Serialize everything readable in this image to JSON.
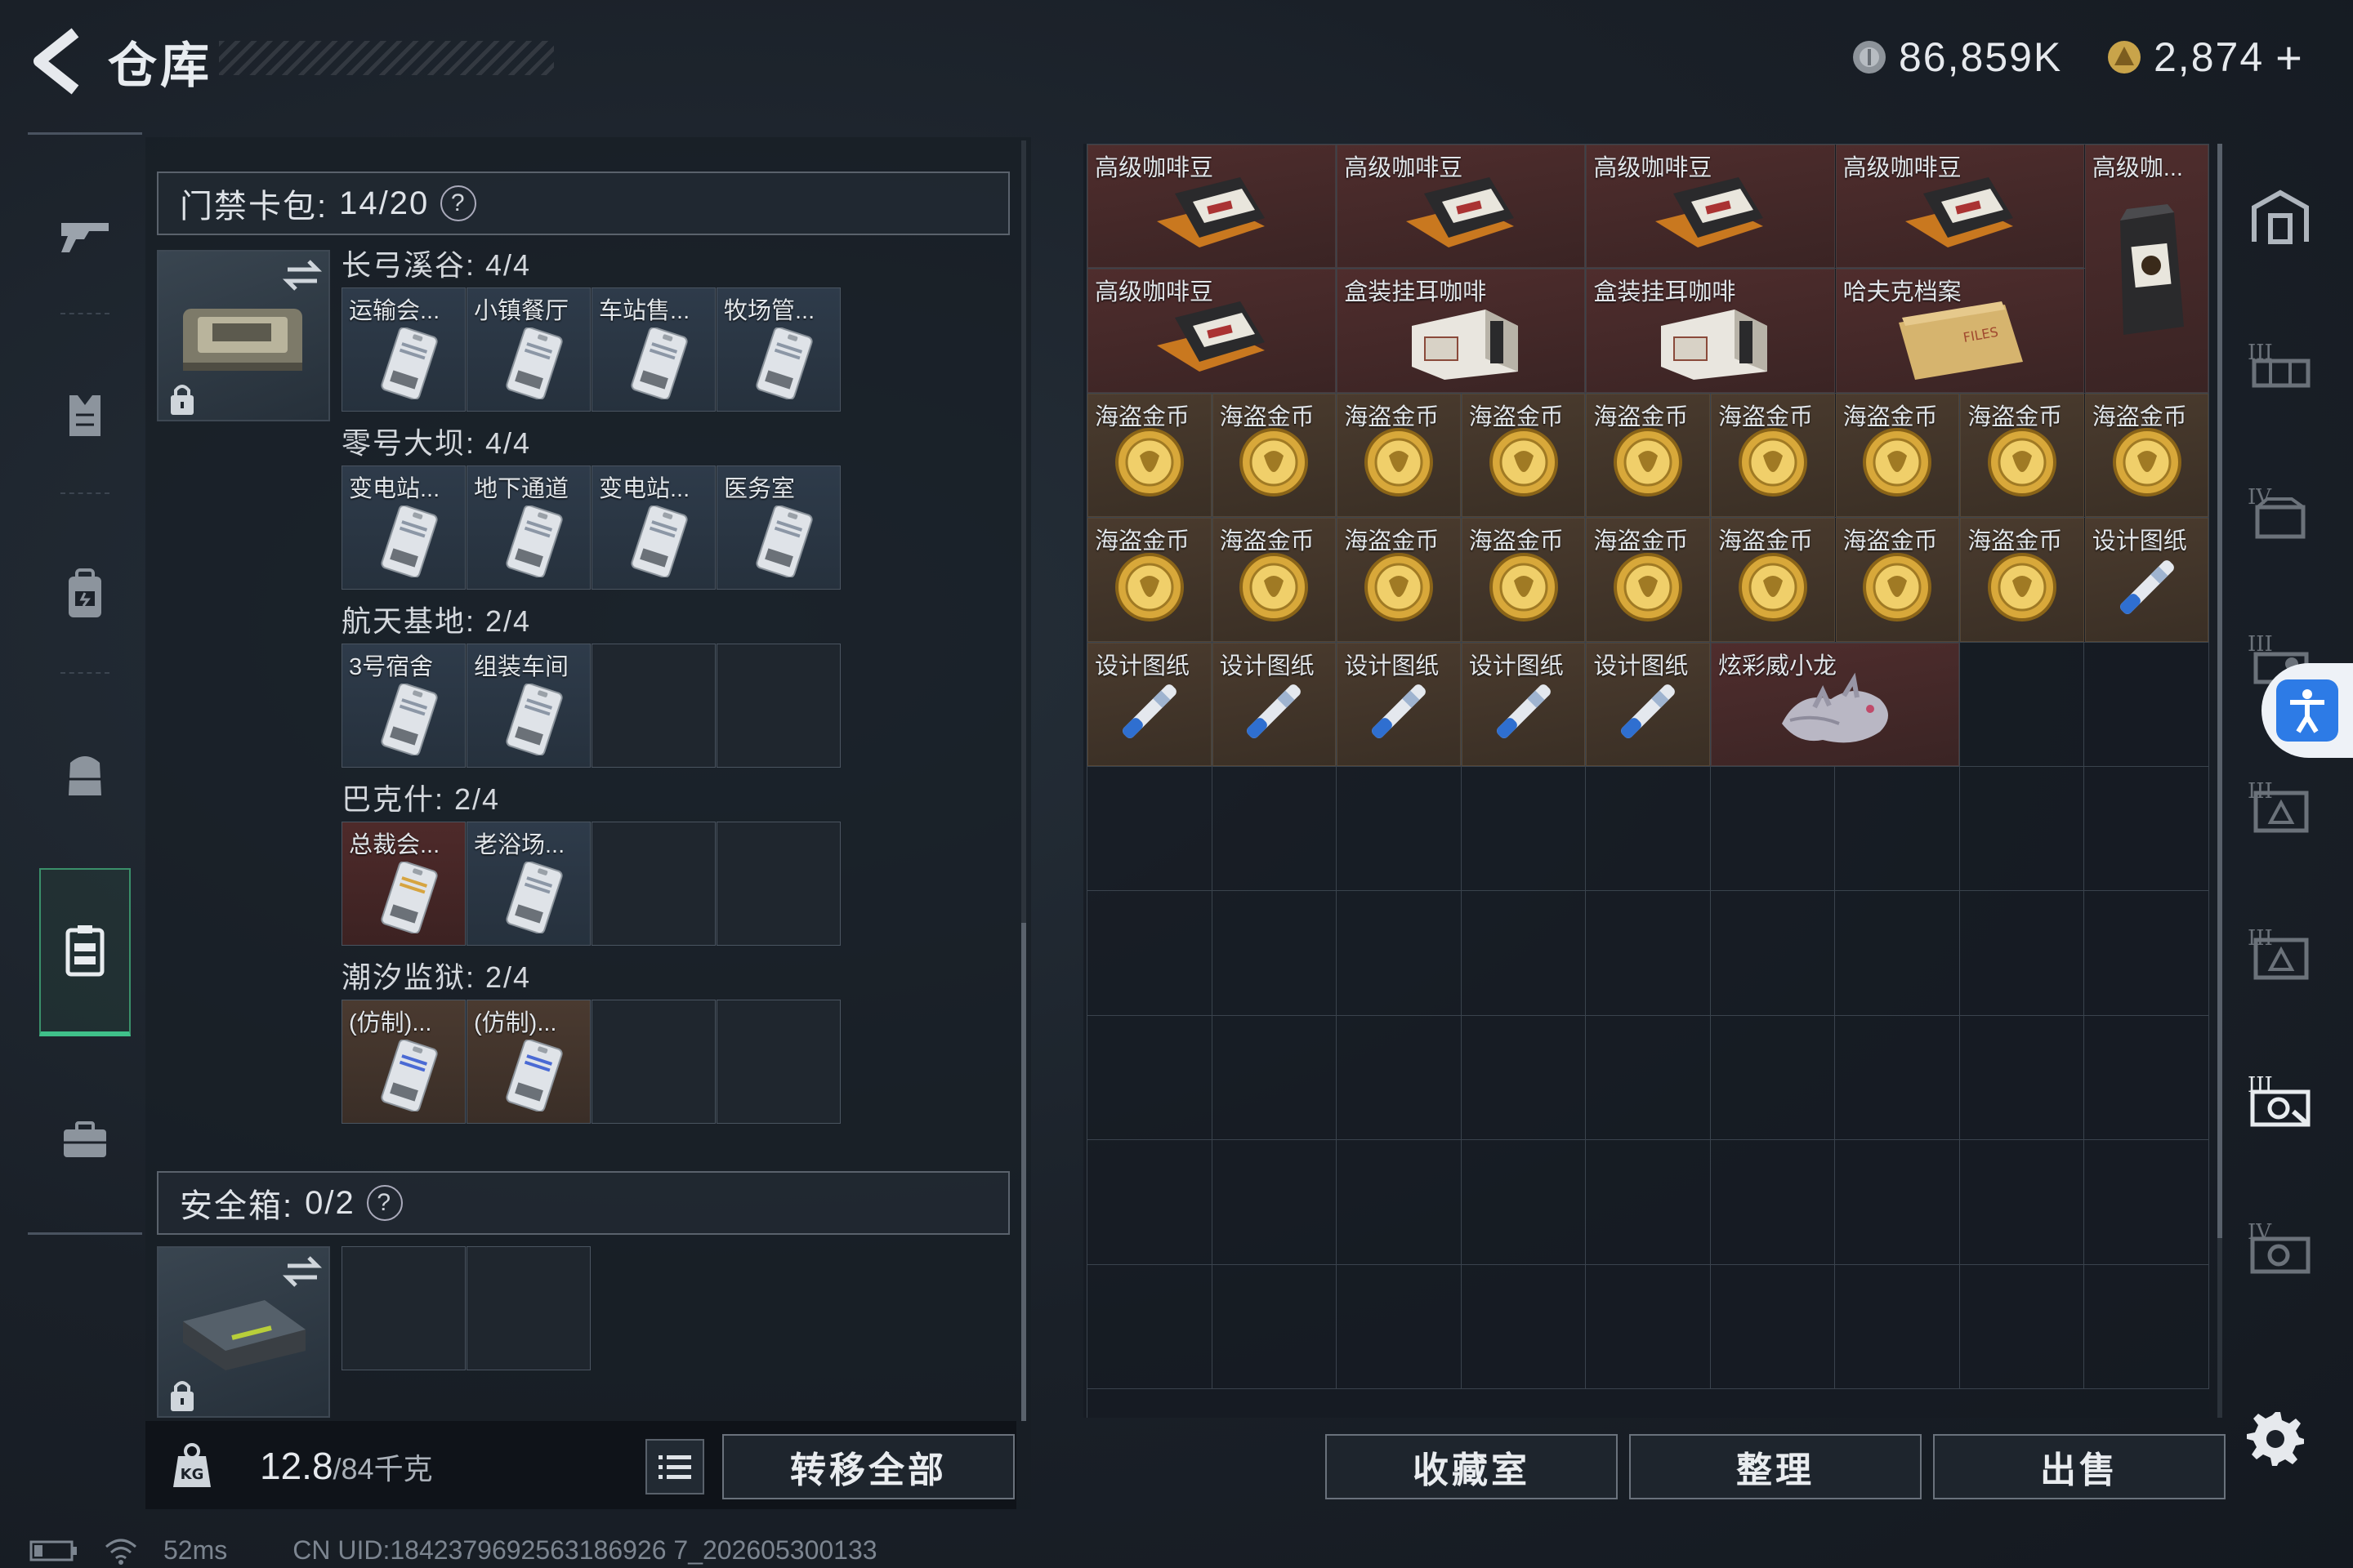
{
  "header": {
    "title": "仓库",
    "currency_1": "86,859K",
    "currency_2": "2,874",
    "currency_2_add": "+"
  },
  "nav": {
    "icons": [
      "gun-icon",
      "armor-vest-icon",
      "backpack-icon",
      "chest-rig-icon",
      "keycard-case-icon",
      "briefcase-icon"
    ],
    "active_index": 4
  },
  "keycard_pack": {
    "label": "门禁卡包:",
    "count": "14/20",
    "help": "?",
    "groups": [
      {
        "title": "长弓溪谷: 4/4",
        "cards": [
          {
            "label": "运输会...",
            "bg": "blue"
          },
          {
            "label": "小镇餐厅",
            "bg": "blue"
          },
          {
            "label": "车站售...",
            "bg": "blue"
          },
          {
            "label": "牧场管...",
            "bg": "blue"
          }
        ]
      },
      {
        "title": "零号大坝: 4/4",
        "cards": [
          {
            "label": "变电站...",
            "bg": "blue"
          },
          {
            "label": "地下通道",
            "bg": "blue"
          },
          {
            "label": "变电站...",
            "bg": "blue"
          },
          {
            "label": "医务室",
            "bg": "blue"
          }
        ]
      },
      {
        "title": "航天基地: 2/4",
        "cards": [
          {
            "label": "3号宿舍",
            "bg": "blue"
          },
          {
            "label": "组装车间",
            "bg": "blue"
          },
          {
            "label": "",
            "bg": "empty"
          },
          {
            "label": "",
            "bg": "empty"
          }
        ]
      },
      {
        "title": "巴克什: 2/4",
        "cards": [
          {
            "label": "总裁会...",
            "bg": "red"
          },
          {
            "label": "老浴场...",
            "bg": "blue"
          },
          {
            "label": "",
            "bg": "empty"
          },
          {
            "label": "",
            "bg": "empty"
          }
        ]
      },
      {
        "title": "潮汐监狱: 2/4",
        "cards": [
          {
            "label": "(仿制)...",
            "bg": "brown"
          },
          {
            "label": "(仿制)...",
            "bg": "brown"
          },
          {
            "label": "",
            "bg": "empty"
          },
          {
            "label": "",
            "bg": "empty"
          }
        ]
      }
    ]
  },
  "safe_box": {
    "label": "安全箱:",
    "count": "0/2",
    "help": "?"
  },
  "weight": {
    "current": "12.8",
    "max": "/84千克"
  },
  "buttons": {
    "transfer_all": "转移全部",
    "collection": "收藏室",
    "sort": "整理",
    "sell": "出售"
  },
  "stash_items": [
    {
      "label": "高级咖啡豆",
      "col": 1,
      "row": 1,
      "w": 2,
      "h": 1,
      "bg": "red",
      "icon": "coffee-bag"
    },
    {
      "label": "高级咖啡豆",
      "col": 3,
      "row": 1,
      "w": 2,
      "h": 1,
      "bg": "red",
      "icon": "coffee-bag"
    },
    {
      "label": "高级咖啡豆",
      "col": 5,
      "row": 1,
      "w": 2,
      "h": 1,
      "bg": "red",
      "icon": "coffee-bag"
    },
    {
      "label": "高级咖啡豆",
      "col": 7,
      "row": 1,
      "w": 2,
      "h": 1,
      "bg": "red",
      "icon": "coffee-bag"
    },
    {
      "label": "高级咖...",
      "col": 9,
      "row": 1,
      "w": 1,
      "h": 2,
      "bg": "red",
      "icon": "coffee-bag-tall"
    },
    {
      "label": "高级咖啡豆",
      "col": 1,
      "row": 2,
      "w": 2,
      "h": 1,
      "bg": "red",
      "icon": "coffee-bag"
    },
    {
      "label": "盒装挂耳咖啡",
      "col": 3,
      "row": 2,
      "w": 2,
      "h": 1,
      "bg": "red",
      "icon": "coffee-box"
    },
    {
      "label": "盒装挂耳咖啡",
      "col": 5,
      "row": 2,
      "w": 2,
      "h": 1,
      "bg": "red",
      "icon": "coffee-box"
    },
    {
      "label": "哈夫克档案",
      "col": 7,
      "row": 2,
      "w": 2,
      "h": 1,
      "bg": "red",
      "icon": "file-folder"
    },
    {
      "label": "海盗金币",
      "col": 1,
      "row": 3,
      "w": 1,
      "h": 1,
      "bg": "brown",
      "icon": "gold-coin"
    },
    {
      "label": "海盗金币",
      "col": 2,
      "row": 3,
      "w": 1,
      "h": 1,
      "bg": "brown",
      "icon": "gold-coin"
    },
    {
      "label": "海盗金币",
      "col": 3,
      "row": 3,
      "w": 1,
      "h": 1,
      "bg": "brown",
      "icon": "gold-coin"
    },
    {
      "label": "海盗金币",
      "col": 4,
      "row": 3,
      "w": 1,
      "h": 1,
      "bg": "brown",
      "icon": "gold-coin"
    },
    {
      "label": "海盗金币",
      "col": 5,
      "row": 3,
      "w": 1,
      "h": 1,
      "bg": "brown",
      "icon": "gold-coin"
    },
    {
      "label": "海盗金币",
      "col": 6,
      "row": 3,
      "w": 1,
      "h": 1,
      "bg": "brown",
      "icon": "gold-coin"
    },
    {
      "label": "海盗金币",
      "col": 7,
      "row": 3,
      "w": 1,
      "h": 1,
      "bg": "brown",
      "icon": "gold-coin"
    },
    {
      "label": "海盗金币",
      "col": 8,
      "row": 3,
      "w": 1,
      "h": 1,
      "bg": "brown",
      "icon": "gold-coin"
    },
    {
      "label": "海盗金币",
      "col": 9,
      "row": 3,
      "w": 1,
      "h": 1,
      "bg": "brown",
      "icon": "gold-coin"
    },
    {
      "label": "海盗金币",
      "col": 1,
      "row": 4,
      "w": 1,
      "h": 1,
      "bg": "brown",
      "icon": "gold-coin"
    },
    {
      "label": "海盗金币",
      "col": 2,
      "row": 4,
      "w": 1,
      "h": 1,
      "bg": "brown",
      "icon": "gold-coin"
    },
    {
      "label": "海盗金币",
      "col": 3,
      "row": 4,
      "w": 1,
      "h": 1,
      "bg": "brown",
      "icon": "gold-coin"
    },
    {
      "label": "海盗金币",
      "col": 4,
      "row": 4,
      "w": 1,
      "h": 1,
      "bg": "brown",
      "icon": "gold-coin"
    },
    {
      "label": "海盗金币",
      "col": 5,
      "row": 4,
      "w": 1,
      "h": 1,
      "bg": "brown",
      "icon": "gold-coin"
    },
    {
      "label": "海盗金币",
      "col": 6,
      "row": 4,
      "w": 1,
      "h": 1,
      "bg": "brown",
      "icon": "gold-coin"
    },
    {
      "label": "海盗金币",
      "col": 7,
      "row": 4,
      "w": 1,
      "h": 1,
      "bg": "brown",
      "icon": "gold-coin"
    },
    {
      "label": "海盗金币",
      "col": 8,
      "row": 4,
      "w": 1,
      "h": 1,
      "bg": "brown",
      "icon": "gold-coin"
    },
    {
      "label": "设计图纸",
      "col": 9,
      "row": 4,
      "w": 1,
      "h": 1,
      "bg": "brown",
      "icon": "blueprint-tube"
    },
    {
      "label": "设计图纸",
      "col": 1,
      "row": 5,
      "w": 1,
      "h": 1,
      "bg": "brown",
      "icon": "blueprint-tube"
    },
    {
      "label": "设计图纸",
      "col": 2,
      "row": 5,
      "w": 1,
      "h": 1,
      "bg": "brown",
      "icon": "blueprint-tube"
    },
    {
      "label": "设计图纸",
      "col": 3,
      "row": 5,
      "w": 1,
      "h": 1,
      "bg": "brown",
      "icon": "blueprint-tube"
    },
    {
      "label": "设计图纸",
      "col": 4,
      "row": 5,
      "w": 1,
      "h": 1,
      "bg": "brown",
      "icon": "blueprint-tube"
    },
    {
      "label": "设计图纸",
      "col": 5,
      "row": 5,
      "w": 1,
      "h": 1,
      "bg": "brown",
      "icon": "blueprint-tube"
    },
    {
      "label": "炫彩威小龙",
      "col": 6,
      "row": 5,
      "w": 2,
      "h": 1,
      "bg": "red",
      "icon": "dragon-figurine"
    }
  ],
  "right_tabs": [
    "stash-home-icon",
    "stash-tab-3-icon",
    "stash-tab-4-icon",
    "stash-tab-5-icon",
    "stash-tab-6-icon",
    "stash-tab-7-icon",
    "stash-tab-8-icon",
    "stash-tab-9-icon"
  ],
  "status": {
    "ping": "52ms",
    "uid": "CN UID:1842379692563186926 7_202605300133"
  },
  "colors": {
    "accent_green": "#3fc08a",
    "item_red": "#4e2a2a",
    "item_brown": "#4a3a30",
    "card_blue": "#2e3b4a",
    "accessibility_blue": "#2d7be6"
  }
}
